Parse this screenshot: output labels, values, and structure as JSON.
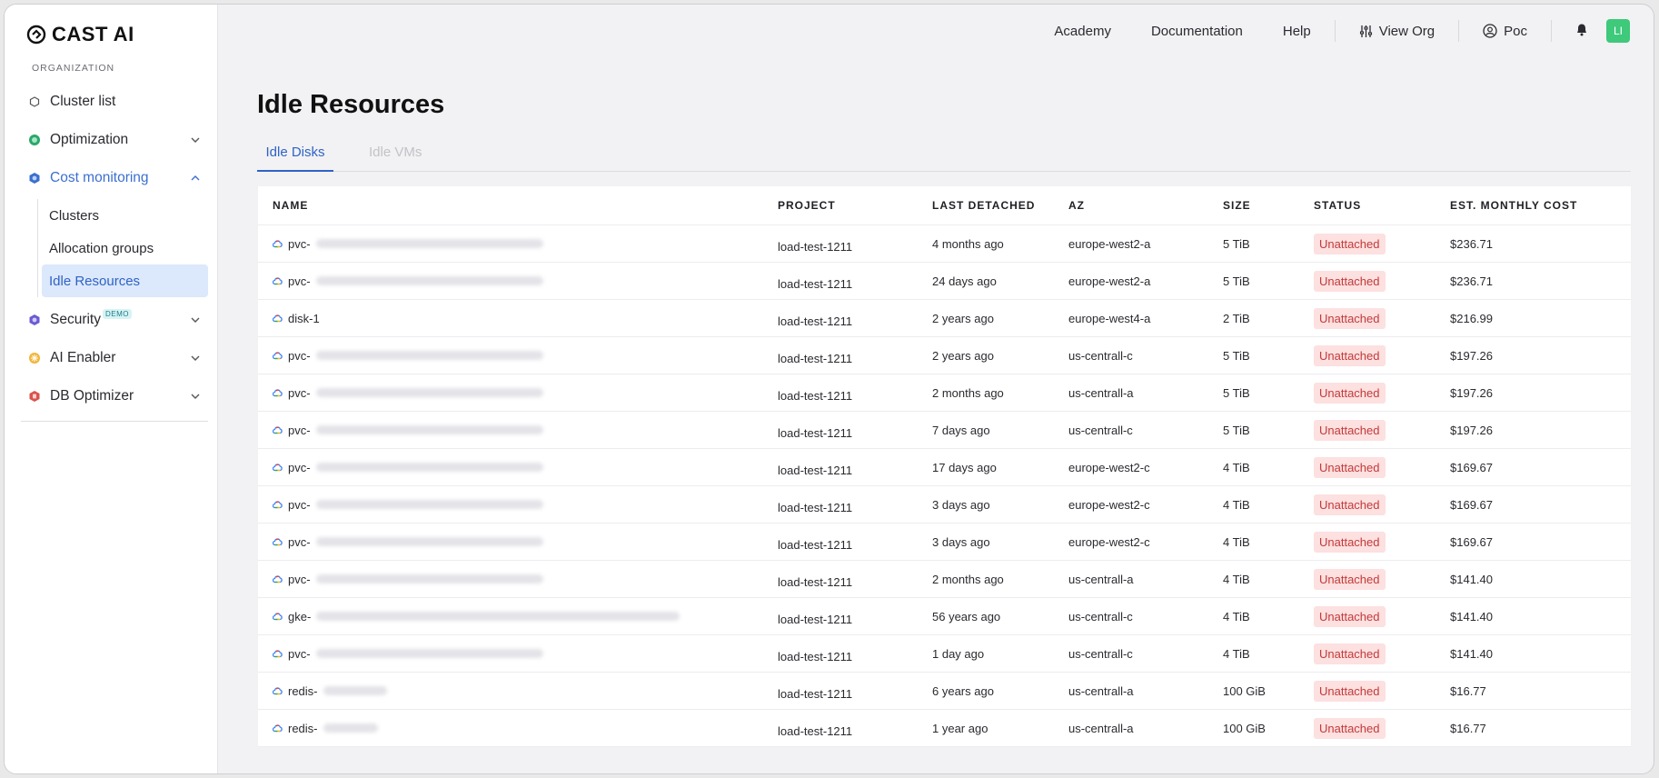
{
  "brand": {
    "name": "CAST AI"
  },
  "sidebar": {
    "section_label": "ORGANIZATION",
    "items": [
      {
        "label": "Cluster list"
      },
      {
        "label": "Optimization"
      },
      {
        "label": "Cost monitoring"
      },
      {
        "label": "Security",
        "badge": "DEMO"
      },
      {
        "label": "AI Enabler"
      },
      {
        "label": "DB Optimizer"
      }
    ],
    "cost_sub": [
      {
        "label": "Clusters"
      },
      {
        "label": "Allocation groups"
      },
      {
        "label": "Idle Resources"
      }
    ]
  },
  "topbar": {
    "academy": "Academy",
    "documentation": "Documentation",
    "help": "Help",
    "view_org": "View Org",
    "org": "Poc",
    "avatar": "LI"
  },
  "page": {
    "title": "Idle Resources",
    "tabs": [
      "Idle Disks",
      "Idle VMs"
    ]
  },
  "table": {
    "columns": [
      "NAME",
      "PROJECT",
      "LAST DETACHED",
      "AZ",
      "SIZE",
      "STATUS",
      "EST. MONTHLY COST"
    ],
    "rows": [
      {
        "name": "pvc-",
        "project": "load-test-1211",
        "detached": "4 months ago",
        "az": "europe-west2-a",
        "size": "5 TiB",
        "status": "Unattached",
        "cost": "$236.71"
      },
      {
        "name": "pvc-",
        "project": "load-test-1211",
        "detached": "24 days ago",
        "az": "europe-west2-a",
        "size": "5 TiB",
        "status": "Unattached",
        "cost": "$236.71"
      },
      {
        "name": "disk-1",
        "project": "load-test-1211",
        "detached": "2 years ago",
        "az": "europe-west4-a",
        "size": "2 TiB",
        "status": "Unattached",
        "cost": "$216.99"
      },
      {
        "name": "pvc-",
        "project": "load-test-1211",
        "detached": "2 years ago",
        "az": "us-centrall-c",
        "size": "5 TiB",
        "status": "Unattached",
        "cost": "$197.26"
      },
      {
        "name": "pvc-",
        "project": "load-test-1211",
        "detached": "2 months ago",
        "az": "us-centrall-a",
        "size": "5 TiB",
        "status": "Unattached",
        "cost": "$197.26"
      },
      {
        "name": "pvc-",
        "project": "load-test-1211",
        "detached": "7 days ago",
        "az": "us-centrall-c",
        "size": "5 TiB",
        "status": "Unattached",
        "cost": "$197.26"
      },
      {
        "name": "pvc-",
        "project": "load-test-1211",
        "detached": "17 days ago",
        "az": "europe-west2-c",
        "size": "4 TiB",
        "status": "Unattached",
        "cost": "$169.67"
      },
      {
        "name": "pvc-",
        "project": "load-test-1211",
        "detached": "3 days ago",
        "az": "europe-west2-c",
        "size": "4 TiB",
        "status": "Unattached",
        "cost": "$169.67"
      },
      {
        "name": "pvc-",
        "project": "load-test-1211",
        "detached": "3 days ago",
        "az": "europe-west2-c",
        "size": "4 TiB",
        "status": "Unattached",
        "cost": "$169.67"
      },
      {
        "name": "pvc-",
        "project": "load-test-1211",
        "detached": "2 months ago",
        "az": "us-centrall-a",
        "size": "4 TiB",
        "status": "Unattached",
        "cost": "$141.40"
      },
      {
        "name": "gke-",
        "project": "load-test-1211",
        "detached": "56 years ago",
        "az": "us-centrall-c",
        "size": "4 TiB",
        "status": "Unattached",
        "cost": "$141.40"
      },
      {
        "name": "pvc-",
        "project": "load-test-1211",
        "detached": "1 day ago",
        "az": "us-centrall-c",
        "size": "4 TiB",
        "status": "Unattached",
        "cost": "$141.40"
      },
      {
        "name": "redis-",
        "project": "load-test-1211",
        "detached": "6 years ago",
        "az": "us-centrall-a",
        "size": "100 GiB",
        "status": "Unattached",
        "cost": "$16.77"
      },
      {
        "name": "redis-",
        "project": "load-test-1211",
        "detached": "1 year ago",
        "az": "us-centrall-a",
        "size": "100 GiB",
        "status": "Unattached",
        "cost": "$16.77"
      }
    ]
  },
  "colors": {
    "accent": "#2f63c6",
    "status_bg": "#fde0e0",
    "status_fg": "#c23a3a",
    "avatar": "#3ec97b"
  }
}
